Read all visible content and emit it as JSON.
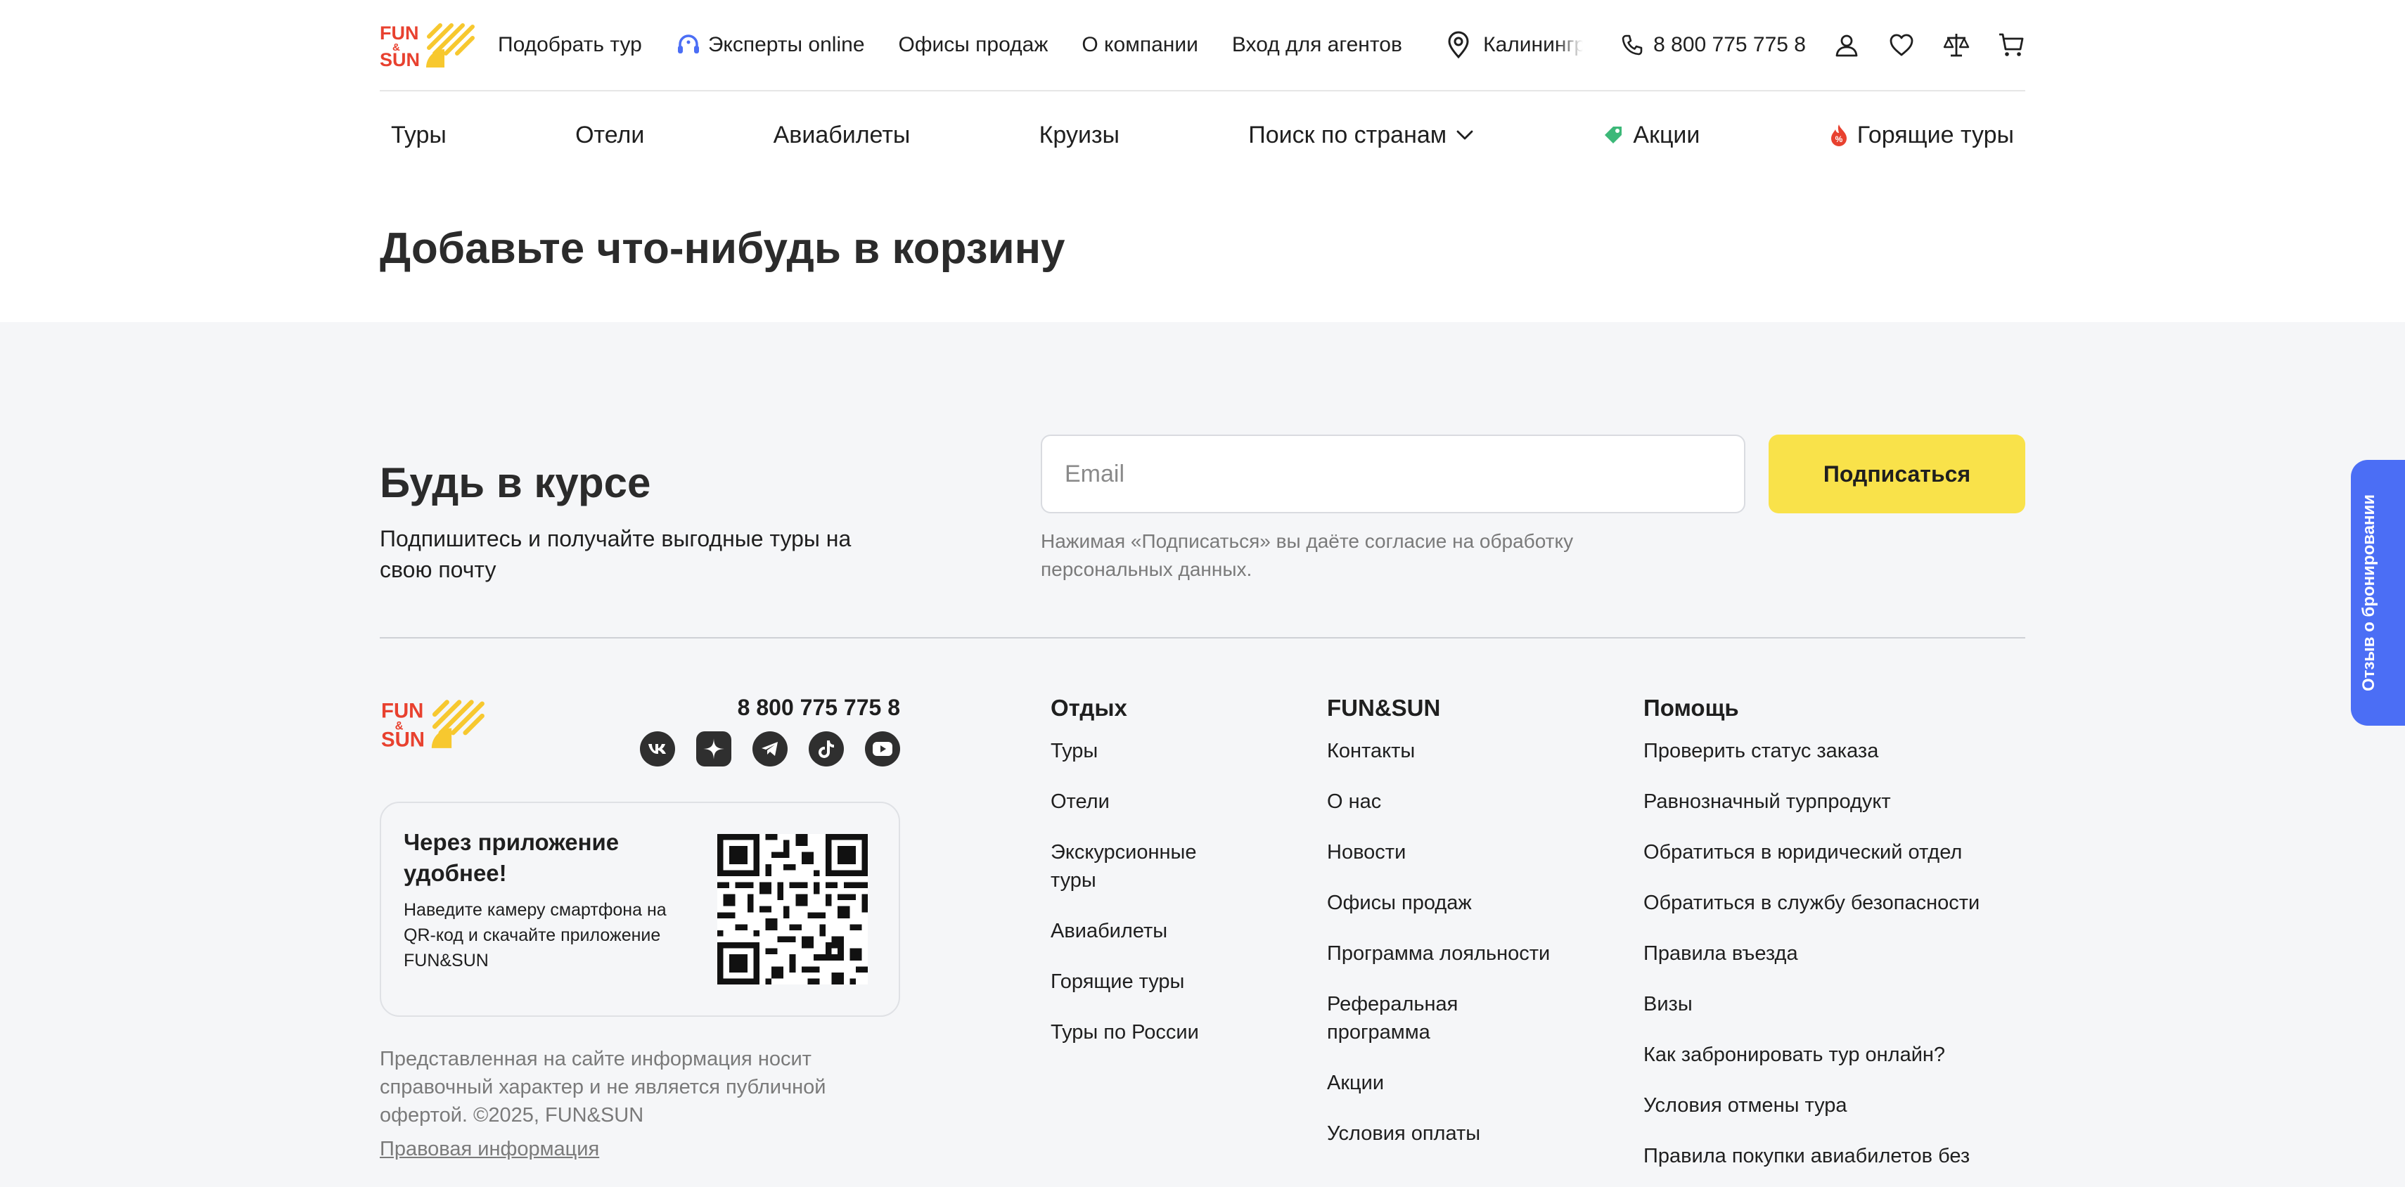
{
  "brand": {
    "name": "FUN&SUN",
    "logo_top": "FUN",
    "logo_amp": "&",
    "logo_bottom": "SUN"
  },
  "header": {
    "nav": [
      "Подобрать тур",
      "Эксперты online",
      "Офисы продаж",
      "О компании",
      "Вход для агентов"
    ],
    "city": "Калининград",
    "phone": "8 800 775 775 8",
    "icons": [
      "user-icon",
      "heart-icon",
      "compare-scales-icon",
      "cart-icon"
    ]
  },
  "main_nav": {
    "tours": "Туры",
    "hotels": "Отели",
    "flights": "Авиабилеты",
    "cruises": "Круизы",
    "countries": "Поиск по странам",
    "promo": "Акции",
    "hot": "Горящие туры"
  },
  "cart": {
    "empty_title": "Добавьте что-нибудь в корзину"
  },
  "subscribe": {
    "title": "Будь в курсе",
    "text": "Подпишитесь и получайте выгодные туры на свою почту",
    "placeholder": "Email",
    "button": "Подписаться",
    "consent": "Нажимая «Подписаться» вы даёте согласие на обработку персональных данных."
  },
  "footer": {
    "phone": "8 800 775 775 8",
    "socials": [
      "vk-icon",
      "dzen-icon",
      "telegram-icon",
      "tiktok-icon",
      "youtube-icon"
    ],
    "app_card": {
      "title": "Через приложение удобнее!",
      "text": "Наведите камеру смартфона на QR-код и скачайте приложение FUN&SUN"
    },
    "disclaimer": "Представленная на сайте информация носит справочный характер и не является публичной офертой. ©2025, FUN&SUN",
    "legal": "Правовая информация",
    "col1": {
      "title": "Отдых",
      "items": [
        "Туры",
        "Отели",
        "Экскурсионные туры",
        "Авиабилеты",
        "Горящие туры",
        "Туры по России"
      ]
    },
    "col2": {
      "title": "FUN&SUN",
      "items": [
        "Контакты",
        "О нас",
        "Новости",
        "Офисы продаж",
        "Программа лояльности",
        "Реферальная программа",
        "Акции",
        "Условия оплаты"
      ]
    },
    "col3": {
      "title": "Помощь",
      "items": [
        "Проверить статус заказа",
        "Равнозначный турпродукт",
        "Обратиться в юридический отдел",
        "Обратиться в службу безопасности",
        "Правила въезда",
        "Визы",
        "Как забронировать тур онлайн?",
        "Условия отмены тура",
        "Правила покупки авиабилетов без"
      ]
    }
  },
  "feedback_tab": "Отзыв о бронировании",
  "colors": {
    "accent_yellow": "#f9e24a",
    "brand_red": "#e8412f",
    "feedback_blue": "#4b6ef5"
  }
}
